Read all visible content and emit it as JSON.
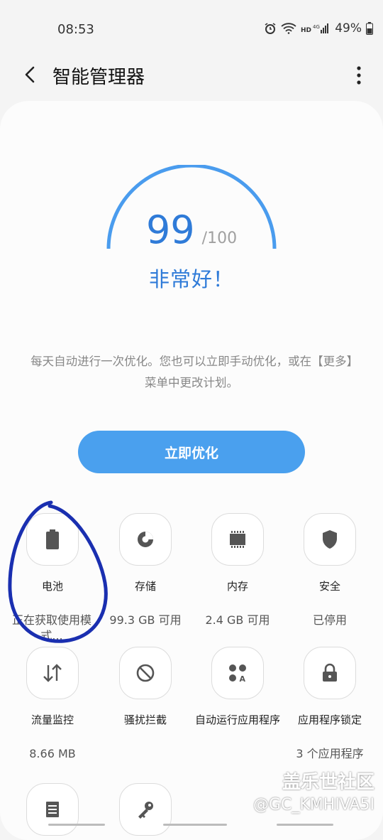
{
  "status": {
    "time": "08:53",
    "battery": "49%"
  },
  "header": {
    "title": "智能管理器"
  },
  "score": {
    "value": "99",
    "max": "/100",
    "label": "非常好！"
  },
  "description": "每天自动进行一次优化。您也可以立即手动优化，或在【更多】菜单中更改计划。",
  "optimize_button": "立即优化",
  "tiles": [
    {
      "label": "电池",
      "value": "正在获取使用模式...",
      "icon": "battery-icon"
    },
    {
      "label": "存储",
      "value": "99.3 GB 可用",
      "icon": "storage-pie-icon"
    },
    {
      "label": "内存",
      "value": "2.4 GB 可用",
      "icon": "memory-chip-icon"
    },
    {
      "label": "安全",
      "value": "已停用",
      "icon": "shield-icon"
    },
    {
      "label": "流量监控",
      "value": "8.66 MB",
      "icon": "data-transfer-icon"
    },
    {
      "label": "骚扰拦截",
      "value": "",
      "icon": "block-icon"
    },
    {
      "label": "自动运行应用程序",
      "value": "",
      "icon": "apps-icon"
    },
    {
      "label": "应用程序锁定",
      "value": "3 个应用程序",
      "icon": "lock-icon"
    }
  ],
  "watermark": {
    "text": "盖乐世社区",
    "id": "@GC_KMHIVA5I"
  },
  "colors": {
    "accent": "#2f7bd8",
    "button": "#4aa0ee",
    "annotation": "#1a2fb0"
  }
}
